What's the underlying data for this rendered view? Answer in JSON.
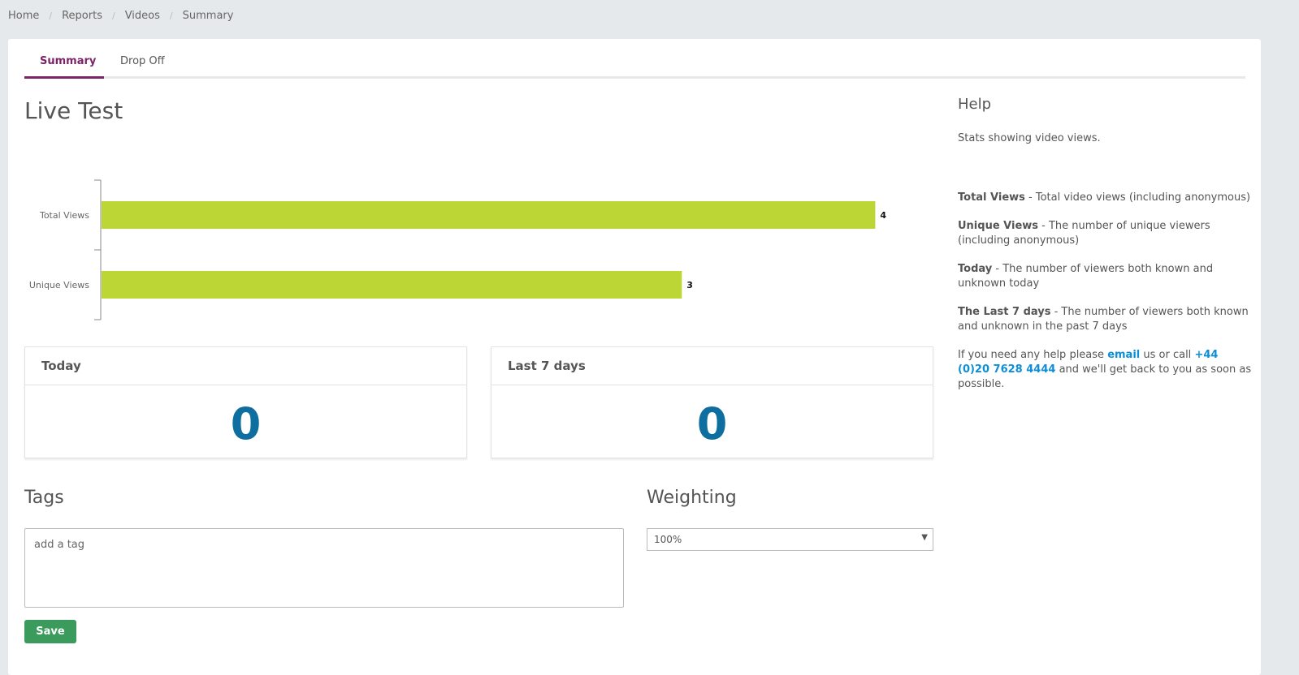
{
  "breadcrumb": [
    "Home",
    "Reports",
    "Videos",
    "Summary"
  ],
  "tabs": [
    {
      "label": "Summary",
      "active": true
    },
    {
      "label": "Drop Off",
      "active": false
    }
  ],
  "page_title": "Live Test",
  "chart_data": {
    "type": "bar",
    "orientation": "horizontal",
    "categories": [
      "Total Views",
      "Unique Views"
    ],
    "values": [
      4,
      3
    ],
    "data_labels": [
      "4",
      "3"
    ],
    "xlim": [
      0,
      4.2
    ],
    "bar_color": "#bcd635"
  },
  "stats": {
    "today": {
      "label": "Today",
      "value": "0"
    },
    "last7": {
      "label": "Last 7 days",
      "value": "0"
    }
  },
  "tags": {
    "heading": "Tags",
    "placeholder": "add a tag"
  },
  "weighting": {
    "heading": "Weighting",
    "selected": "100%"
  },
  "save_label": "Save",
  "help": {
    "title": "Help",
    "intro": "Stats showing video views.",
    "items": [
      {
        "term": "Total Views",
        "desc": " - Total video views (including anonymous)"
      },
      {
        "term": "Unique Views",
        "desc": " - The number of unique viewers (including anonymous)"
      },
      {
        "term": "Today",
        "desc": " - The number of viewers both known and unknown today"
      },
      {
        "term": "The Last 7 days",
        "desc": " - The number of viewers both known and unknown in the past 7 days"
      }
    ],
    "contact_pre": "If you need any help please ",
    "contact_email": "email",
    "contact_mid": " us or call ",
    "contact_phone": "+44 (0)20 7628 4444",
    "contact_post": " and we'll get back to you as soon as possible."
  },
  "colors": {
    "accent": "#7b2468",
    "stat_value": "#0e6ea0",
    "save_button": "#3a9b5c",
    "link": "#0d8fd8"
  }
}
